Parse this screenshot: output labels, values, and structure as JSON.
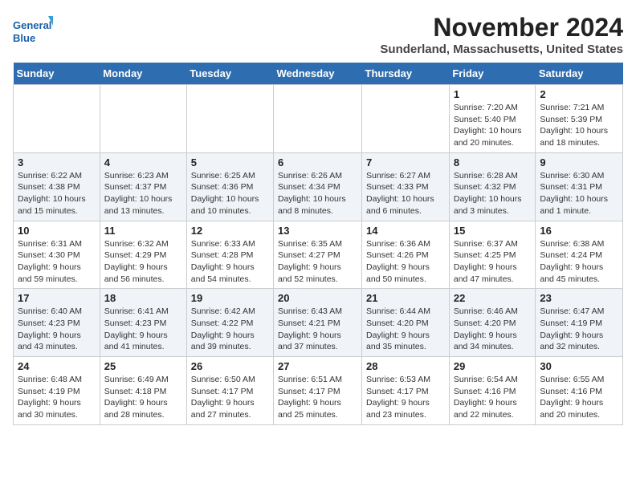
{
  "header": {
    "logo_line1": "General",
    "logo_line2": "Blue",
    "month_title": "November 2024",
    "location": "Sunderland, Massachusetts, United States"
  },
  "weekdays": [
    "Sunday",
    "Monday",
    "Tuesday",
    "Wednesday",
    "Thursday",
    "Friday",
    "Saturday"
  ],
  "weeks": [
    [
      {
        "day": "",
        "info": ""
      },
      {
        "day": "",
        "info": ""
      },
      {
        "day": "",
        "info": ""
      },
      {
        "day": "",
        "info": ""
      },
      {
        "day": "",
        "info": ""
      },
      {
        "day": "1",
        "info": "Sunrise: 7:20 AM\nSunset: 5:40 PM\nDaylight: 10 hours and 20 minutes."
      },
      {
        "day": "2",
        "info": "Sunrise: 7:21 AM\nSunset: 5:39 PM\nDaylight: 10 hours and 18 minutes."
      }
    ],
    [
      {
        "day": "3",
        "info": "Sunrise: 6:22 AM\nSunset: 4:38 PM\nDaylight: 10 hours and 15 minutes."
      },
      {
        "day": "4",
        "info": "Sunrise: 6:23 AM\nSunset: 4:37 PM\nDaylight: 10 hours and 13 minutes."
      },
      {
        "day": "5",
        "info": "Sunrise: 6:25 AM\nSunset: 4:36 PM\nDaylight: 10 hours and 10 minutes."
      },
      {
        "day": "6",
        "info": "Sunrise: 6:26 AM\nSunset: 4:34 PM\nDaylight: 10 hours and 8 minutes."
      },
      {
        "day": "7",
        "info": "Sunrise: 6:27 AM\nSunset: 4:33 PM\nDaylight: 10 hours and 6 minutes."
      },
      {
        "day": "8",
        "info": "Sunrise: 6:28 AM\nSunset: 4:32 PM\nDaylight: 10 hours and 3 minutes."
      },
      {
        "day": "9",
        "info": "Sunrise: 6:30 AM\nSunset: 4:31 PM\nDaylight: 10 hours and 1 minute."
      }
    ],
    [
      {
        "day": "10",
        "info": "Sunrise: 6:31 AM\nSunset: 4:30 PM\nDaylight: 9 hours and 59 minutes."
      },
      {
        "day": "11",
        "info": "Sunrise: 6:32 AM\nSunset: 4:29 PM\nDaylight: 9 hours and 56 minutes."
      },
      {
        "day": "12",
        "info": "Sunrise: 6:33 AM\nSunset: 4:28 PM\nDaylight: 9 hours and 54 minutes."
      },
      {
        "day": "13",
        "info": "Sunrise: 6:35 AM\nSunset: 4:27 PM\nDaylight: 9 hours and 52 minutes."
      },
      {
        "day": "14",
        "info": "Sunrise: 6:36 AM\nSunset: 4:26 PM\nDaylight: 9 hours and 50 minutes."
      },
      {
        "day": "15",
        "info": "Sunrise: 6:37 AM\nSunset: 4:25 PM\nDaylight: 9 hours and 47 minutes."
      },
      {
        "day": "16",
        "info": "Sunrise: 6:38 AM\nSunset: 4:24 PM\nDaylight: 9 hours and 45 minutes."
      }
    ],
    [
      {
        "day": "17",
        "info": "Sunrise: 6:40 AM\nSunset: 4:23 PM\nDaylight: 9 hours and 43 minutes."
      },
      {
        "day": "18",
        "info": "Sunrise: 6:41 AM\nSunset: 4:23 PM\nDaylight: 9 hours and 41 minutes."
      },
      {
        "day": "19",
        "info": "Sunrise: 6:42 AM\nSunset: 4:22 PM\nDaylight: 9 hours and 39 minutes."
      },
      {
        "day": "20",
        "info": "Sunrise: 6:43 AM\nSunset: 4:21 PM\nDaylight: 9 hours and 37 minutes."
      },
      {
        "day": "21",
        "info": "Sunrise: 6:44 AM\nSunset: 4:20 PM\nDaylight: 9 hours and 35 minutes."
      },
      {
        "day": "22",
        "info": "Sunrise: 6:46 AM\nSunset: 4:20 PM\nDaylight: 9 hours and 34 minutes."
      },
      {
        "day": "23",
        "info": "Sunrise: 6:47 AM\nSunset: 4:19 PM\nDaylight: 9 hours and 32 minutes."
      }
    ],
    [
      {
        "day": "24",
        "info": "Sunrise: 6:48 AM\nSunset: 4:19 PM\nDaylight: 9 hours and 30 minutes."
      },
      {
        "day": "25",
        "info": "Sunrise: 6:49 AM\nSunset: 4:18 PM\nDaylight: 9 hours and 28 minutes."
      },
      {
        "day": "26",
        "info": "Sunrise: 6:50 AM\nSunset: 4:17 PM\nDaylight: 9 hours and 27 minutes."
      },
      {
        "day": "27",
        "info": "Sunrise: 6:51 AM\nSunset: 4:17 PM\nDaylight: 9 hours and 25 minutes."
      },
      {
        "day": "28",
        "info": "Sunrise: 6:53 AM\nSunset: 4:17 PM\nDaylight: 9 hours and 23 minutes."
      },
      {
        "day": "29",
        "info": "Sunrise: 6:54 AM\nSunset: 4:16 PM\nDaylight: 9 hours and 22 minutes."
      },
      {
        "day": "30",
        "info": "Sunrise: 6:55 AM\nSunset: 4:16 PM\nDaylight: 9 hours and 20 minutes."
      }
    ]
  ]
}
